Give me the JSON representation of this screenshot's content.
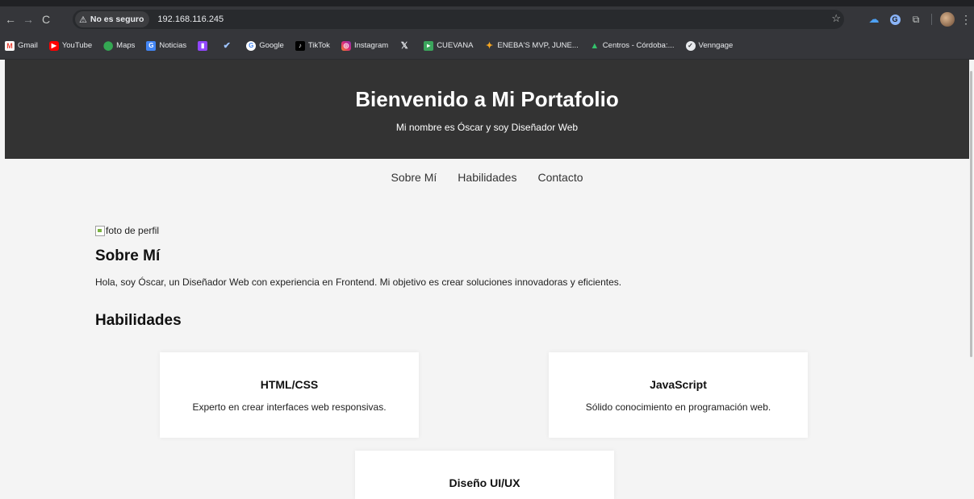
{
  "browser": {
    "security_label": "No es seguro",
    "url": "192.168.116.245",
    "bookmarks": [
      {
        "label": "Gmail",
        "icon": "gmail-icon"
      },
      {
        "label": "YouTube",
        "icon": "youtube-icon"
      },
      {
        "label": "Maps",
        "icon": "maps-icon"
      },
      {
        "label": "Noticias",
        "icon": "news-icon"
      },
      {
        "label": "",
        "icon": "twitch-icon"
      },
      {
        "label": "",
        "icon": "steam-icon"
      },
      {
        "label": "Google",
        "icon": "google-icon"
      },
      {
        "label": "TikTok",
        "icon": "tiktok-icon"
      },
      {
        "label": "Instagram",
        "icon": "instagram-icon"
      },
      {
        "label": "",
        "icon": "x-icon"
      },
      {
        "label": "CUEVANA",
        "icon": "cuevana-icon"
      },
      {
        "label": "ENEBA'S MVP, JUNE...",
        "icon": "eneba-icon"
      },
      {
        "label": "Centros - Córdoba:...",
        "icon": "centros-icon"
      },
      {
        "label": "Venngage",
        "icon": "venngage-icon"
      }
    ]
  },
  "header": {
    "title": "Bienvenido a Mi Portafolio",
    "subtitle": "Mi nombre es Óscar y soy Diseñador Web"
  },
  "nav": {
    "about": "Sobre Mí",
    "skills": "Habilidades",
    "contact": "Contacto"
  },
  "about": {
    "image_alt": "foto de perfil",
    "heading": "Sobre Mí",
    "text": "Hola, soy Óscar, un Diseñador Web con experiencia en Frontend. Mi objetivo es crear soluciones innovadoras y eficientes."
  },
  "skills": {
    "heading": "Habilidades",
    "cards": [
      {
        "title": "HTML/CSS",
        "text": "Experto en crear interfaces web responsivas."
      },
      {
        "title": "JavaScript",
        "text": "Sólido conocimiento en programación web."
      },
      {
        "title": "Diseño UI/UX",
        "text": ""
      }
    ]
  }
}
